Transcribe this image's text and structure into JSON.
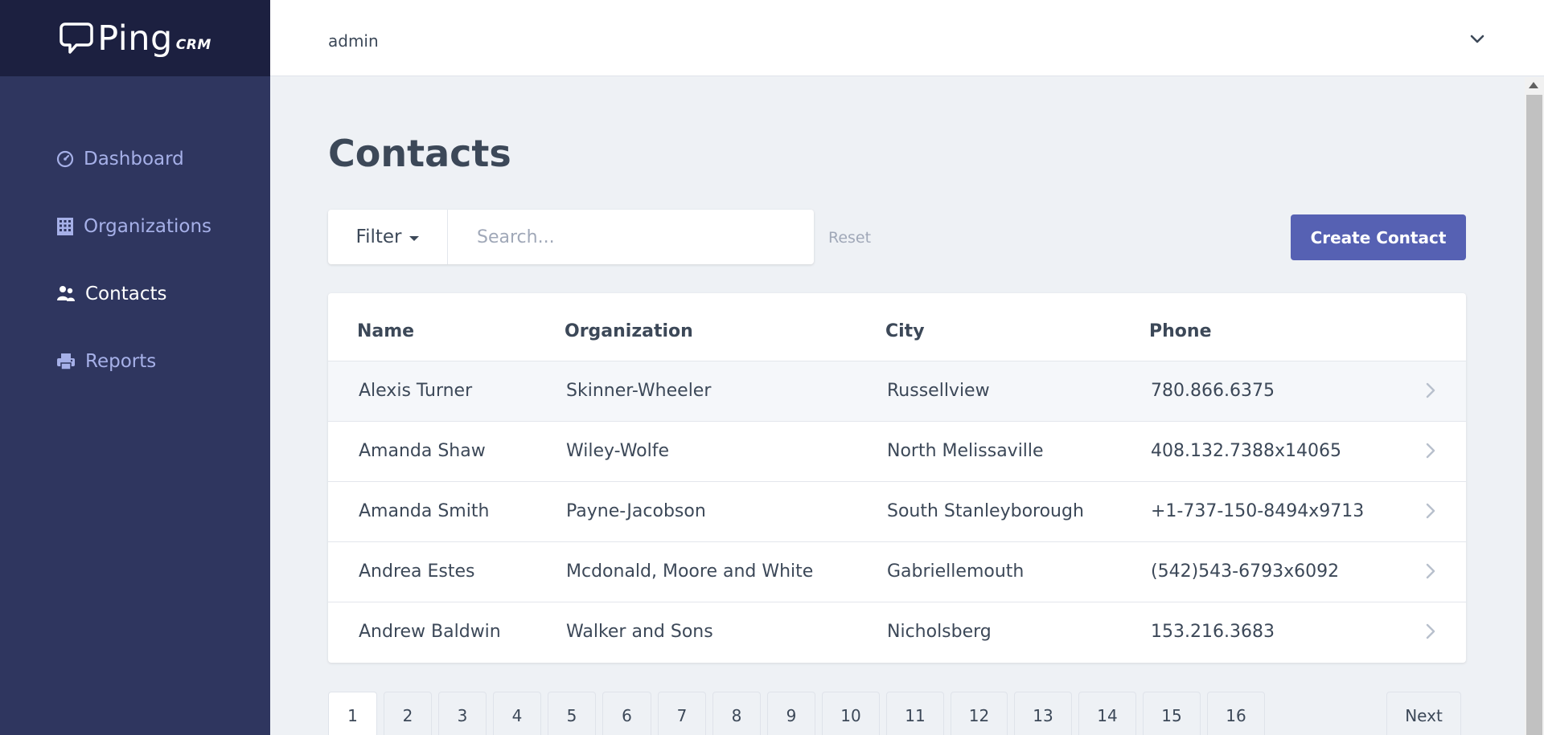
{
  "brand": {
    "name": "Ping",
    "suffix": "CRM"
  },
  "topbar": {
    "user_name": "admin",
    "menu_icon": "chevron-down-icon"
  },
  "sidebar": {
    "items": [
      {
        "label": "Dashboard",
        "icon": "dashboard-icon",
        "active": false
      },
      {
        "label": "Organizations",
        "icon": "office-building-icon",
        "active": false
      },
      {
        "label": "Contacts",
        "icon": "users-icon",
        "active": true
      },
      {
        "label": "Reports",
        "icon": "printer-icon",
        "active": false
      }
    ]
  },
  "main": {
    "title": "Contacts",
    "filter_label": "Filter",
    "search_placeholder": "Search...",
    "reset_label": "Reset",
    "create_label": "Create Contact"
  },
  "table": {
    "columns": [
      "Name",
      "Organization",
      "City",
      "Phone"
    ],
    "rows": [
      {
        "name": "Alexis Turner",
        "organization": "Skinner-Wheeler",
        "city": "Russellview",
        "phone": "780.866.6375"
      },
      {
        "name": "Amanda Shaw",
        "organization": "Wiley-Wolfe",
        "city": "North Melissaville",
        "phone": "408.132.7388x14065"
      },
      {
        "name": "Amanda Smith",
        "organization": "Payne-Jacobson",
        "city": "South Stanleyborough",
        "phone": "+1-737-150-8494x9713"
      },
      {
        "name": "Andrea Estes",
        "organization": "Mcdonald, Moore and White",
        "city": "Gabriellemouth",
        "phone": "(542)543-6793x6092"
      },
      {
        "name": "Andrew Baldwin",
        "organization": "Walker and Sons",
        "city": "Nicholsberg",
        "phone": "153.216.3683"
      }
    ]
  },
  "pagination": {
    "pages": [
      "1",
      "2",
      "3",
      "4",
      "5",
      "6",
      "7",
      "8",
      "9",
      "10",
      "11",
      "12",
      "13",
      "14",
      "15",
      "16"
    ],
    "current": "1",
    "next_label": "Next"
  },
  "colors": {
    "brand_bg": "#1c2040",
    "sidebar_bg": "#2f365f",
    "sidebar_link": "#a6b0e8",
    "accent": "#5661b3",
    "page_bg": "#eef1f5"
  }
}
